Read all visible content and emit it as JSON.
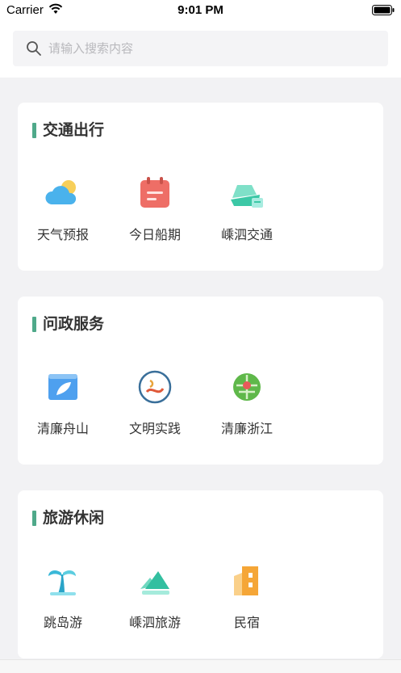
{
  "status_bar": {
    "carrier": "Carrier",
    "time": "9:01 PM"
  },
  "search": {
    "placeholder": "请输入搜索内容"
  },
  "sections": [
    {
      "title": "交通出行",
      "items": [
        {
          "label": "天气预报",
          "icon": "weather-icon"
        },
        {
          "label": "今日船期",
          "icon": "calendar-icon"
        },
        {
          "label": "嵊泗交通",
          "icon": "ferry-icon"
        }
      ]
    },
    {
      "title": "问政服务",
      "items": [
        {
          "label": "清廉舟山",
          "icon": "leaf-window-icon"
        },
        {
          "label": "文明实践",
          "icon": "civilization-logo-icon"
        },
        {
          "label": "清廉浙江",
          "icon": "lotus-icon"
        }
      ]
    },
    {
      "title": "旅游休闲",
      "items": [
        {
          "label": "跳岛游",
          "icon": "palm-island-icon"
        },
        {
          "label": "嵊泗旅游",
          "icon": "mountain-icon"
        },
        {
          "label": "民宿",
          "icon": "building-icon"
        }
      ]
    }
  ],
  "colors": {
    "accent": "#4fa98a",
    "background": "#f2f2f4"
  }
}
